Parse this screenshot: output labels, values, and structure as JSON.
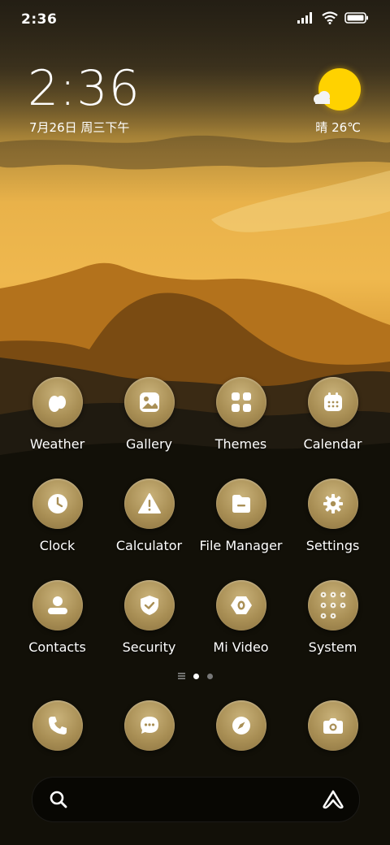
{
  "status_bar": {
    "time": "2:36"
  },
  "lockwidget": {
    "time": "2:36",
    "date": "7月26日 周三下午"
  },
  "weather": {
    "text": "晴 26℃"
  },
  "apps": [
    {
      "label": "Weather",
      "icon": "weather-icon"
    },
    {
      "label": "Gallery",
      "icon": "gallery-icon"
    },
    {
      "label": "Themes",
      "icon": "themes-icon"
    },
    {
      "label": "Calendar",
      "icon": "calendar-icon"
    },
    {
      "label": "Clock",
      "icon": "clock-icon"
    },
    {
      "label": "Calculator",
      "icon": "calculator-icon"
    },
    {
      "label": "File Manager",
      "icon": "file-manager-icon"
    },
    {
      "label": "Settings",
      "icon": "settings-icon"
    },
    {
      "label": "Contacts",
      "icon": "contacts-icon"
    },
    {
      "label": "Security",
      "icon": "security-icon"
    },
    {
      "label": "Mi Video",
      "icon": "mi-video-icon"
    },
    {
      "label": "System",
      "icon": "system-folder-icon"
    }
  ],
  "dock": [
    {
      "icon": "phone-icon"
    },
    {
      "icon": "messages-icon"
    },
    {
      "icon": "browser-icon"
    },
    {
      "icon": "camera-icon"
    }
  ],
  "page_indicator": {
    "pages": 2,
    "current": 1
  },
  "colors": {
    "icon_bg": "#a98f55",
    "icon_glyph": "#ffffff",
    "sun": "#FFD200"
  }
}
